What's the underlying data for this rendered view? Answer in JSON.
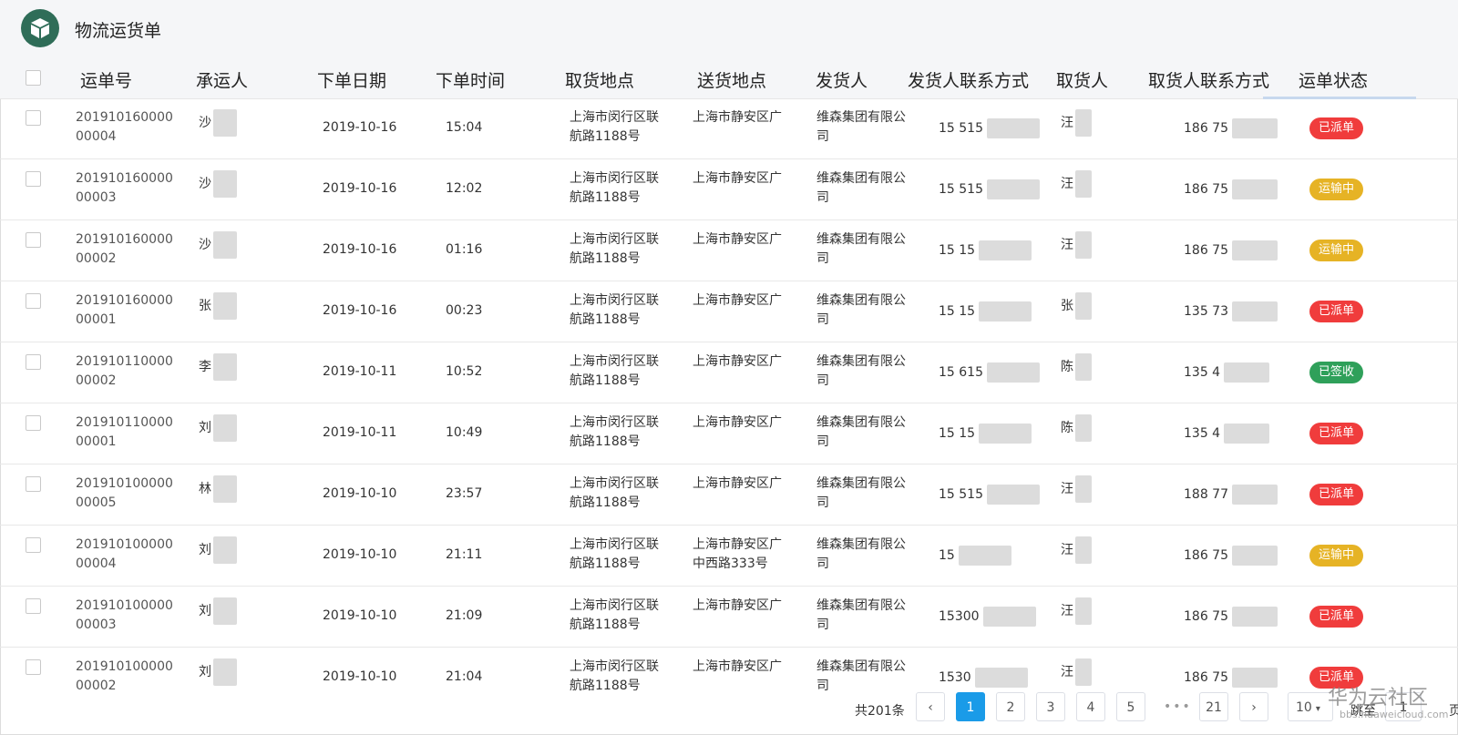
{
  "app": {
    "title": "物流运货单"
  },
  "columns": [
    "运单号",
    "承运人",
    "下单日期",
    "下单时间",
    "取货地点",
    "送货地点",
    "发货人",
    "发货人联系方式",
    "取货人",
    "取货人联系方式",
    "运单状态"
  ],
  "status_colors": {
    "已派单": "#f03c3c",
    "运输中": "#e6b325",
    "已签收": "#2fa05a"
  },
  "rows": [
    {
      "id": "20191016000000004",
      "carrier": "沙",
      "date": "2019-10-16",
      "time": "15:04",
      "pickup": "上海市闵行区联航路1188号",
      "delivery": "上海市静安区广",
      "sender": "维森集团有限公司",
      "sender_phone": "15 515",
      "receiver": "汪",
      "receiver_phone": "186 75",
      "status": "已派单"
    },
    {
      "id": "20191016000000003",
      "carrier": "沙",
      "date": "2019-10-16",
      "time": "12:02",
      "pickup": "上海市闵行区联航路1188号",
      "delivery": "上海市静安区广",
      "sender": "维森集团有限公司",
      "sender_phone": "15 515",
      "receiver": "汪",
      "receiver_phone": "186 75",
      "status": "运输中"
    },
    {
      "id": "20191016000000002",
      "carrier": "沙",
      "date": "2019-10-16",
      "time": "01:16",
      "pickup": "上海市闵行区联航路1188号",
      "delivery": "上海市静安区广",
      "sender": "维森集团有限公司",
      "sender_phone": "15 15",
      "receiver": "汪",
      "receiver_phone": "186 75",
      "status": "运输中"
    },
    {
      "id": "20191016000000001",
      "carrier": "张",
      "date": "2019-10-16",
      "time": "00:23",
      "pickup": "上海市闵行区联航路1188号",
      "delivery": "上海市静安区广",
      "sender": "维森集团有限公司",
      "sender_phone": "15 15",
      "receiver": "张",
      "receiver_phone": "135 73",
      "status": "已派单"
    },
    {
      "id": "20191011000000002",
      "carrier": "李",
      "date": "2019-10-11",
      "time": "10:52",
      "pickup": "上海市闵行区联航路1188号",
      "delivery": "上海市静安区广",
      "sender": "维森集团有限公司",
      "sender_phone": "15 615",
      "receiver": "陈",
      "receiver_phone": "135 4",
      "status": "已签收"
    },
    {
      "id": "20191011000000001",
      "carrier": "刘",
      "date": "2019-10-11",
      "time": "10:49",
      "pickup": "上海市闵行区联航路1188号",
      "delivery": "上海市静安区广",
      "sender": "维森集团有限公司",
      "sender_phone": "15 15",
      "receiver": "陈",
      "receiver_phone": "135 4",
      "status": "已派单"
    },
    {
      "id": "20191010000000005",
      "carrier": "林",
      "date": "2019-10-10",
      "time": "23:57",
      "pickup": "上海市闵行区联航路1188号",
      "delivery": "上海市静安区广",
      "sender": "维森集团有限公司",
      "sender_phone": "15 515",
      "receiver": "汪",
      "receiver_phone": "188 77",
      "status": "已派单"
    },
    {
      "id": "20191010000000004",
      "carrier": "刘",
      "date": "2019-10-10",
      "time": "21:11",
      "pickup": "上海市闵行区联航路1188号",
      "delivery": "上海市静安区广中西路333号",
      "sender": "维森集团有限公司",
      "sender_phone": "15",
      "receiver": "汪",
      "receiver_phone": "186 75",
      "status": "运输中"
    },
    {
      "id": "20191010000000003",
      "carrier": "刘",
      "date": "2019-10-10",
      "time": "21:09",
      "pickup": "上海市闵行区联航路1188号",
      "delivery": "上海市静安区广",
      "sender": "维森集团有限公司",
      "sender_phone": "15300",
      "receiver": "汪",
      "receiver_phone": "186 75",
      "status": "已派单"
    },
    {
      "id": "20191010000000002",
      "carrier": "刘",
      "date": "2019-10-10",
      "time": "21:04",
      "pickup": "上海市闵行区联航路1188号",
      "delivery": "上海市静安区广",
      "sender": "维森集团有限公司",
      "sender_phone": "1530",
      "receiver": "汪",
      "receiver_phone": "186 75",
      "status": "已派单"
    }
  ],
  "pagination": {
    "total_label": "共201条",
    "pages": [
      "1",
      "2",
      "3",
      "4",
      "5",
      "21"
    ],
    "ellipsis": "•••",
    "current": "1",
    "page_size": "10",
    "jump_label": "跳至",
    "jump_value": "1",
    "page_suffix": "页"
  },
  "watermark": {
    "text": "华为云社区",
    "url": "bbs.huaweicloud.com"
  }
}
